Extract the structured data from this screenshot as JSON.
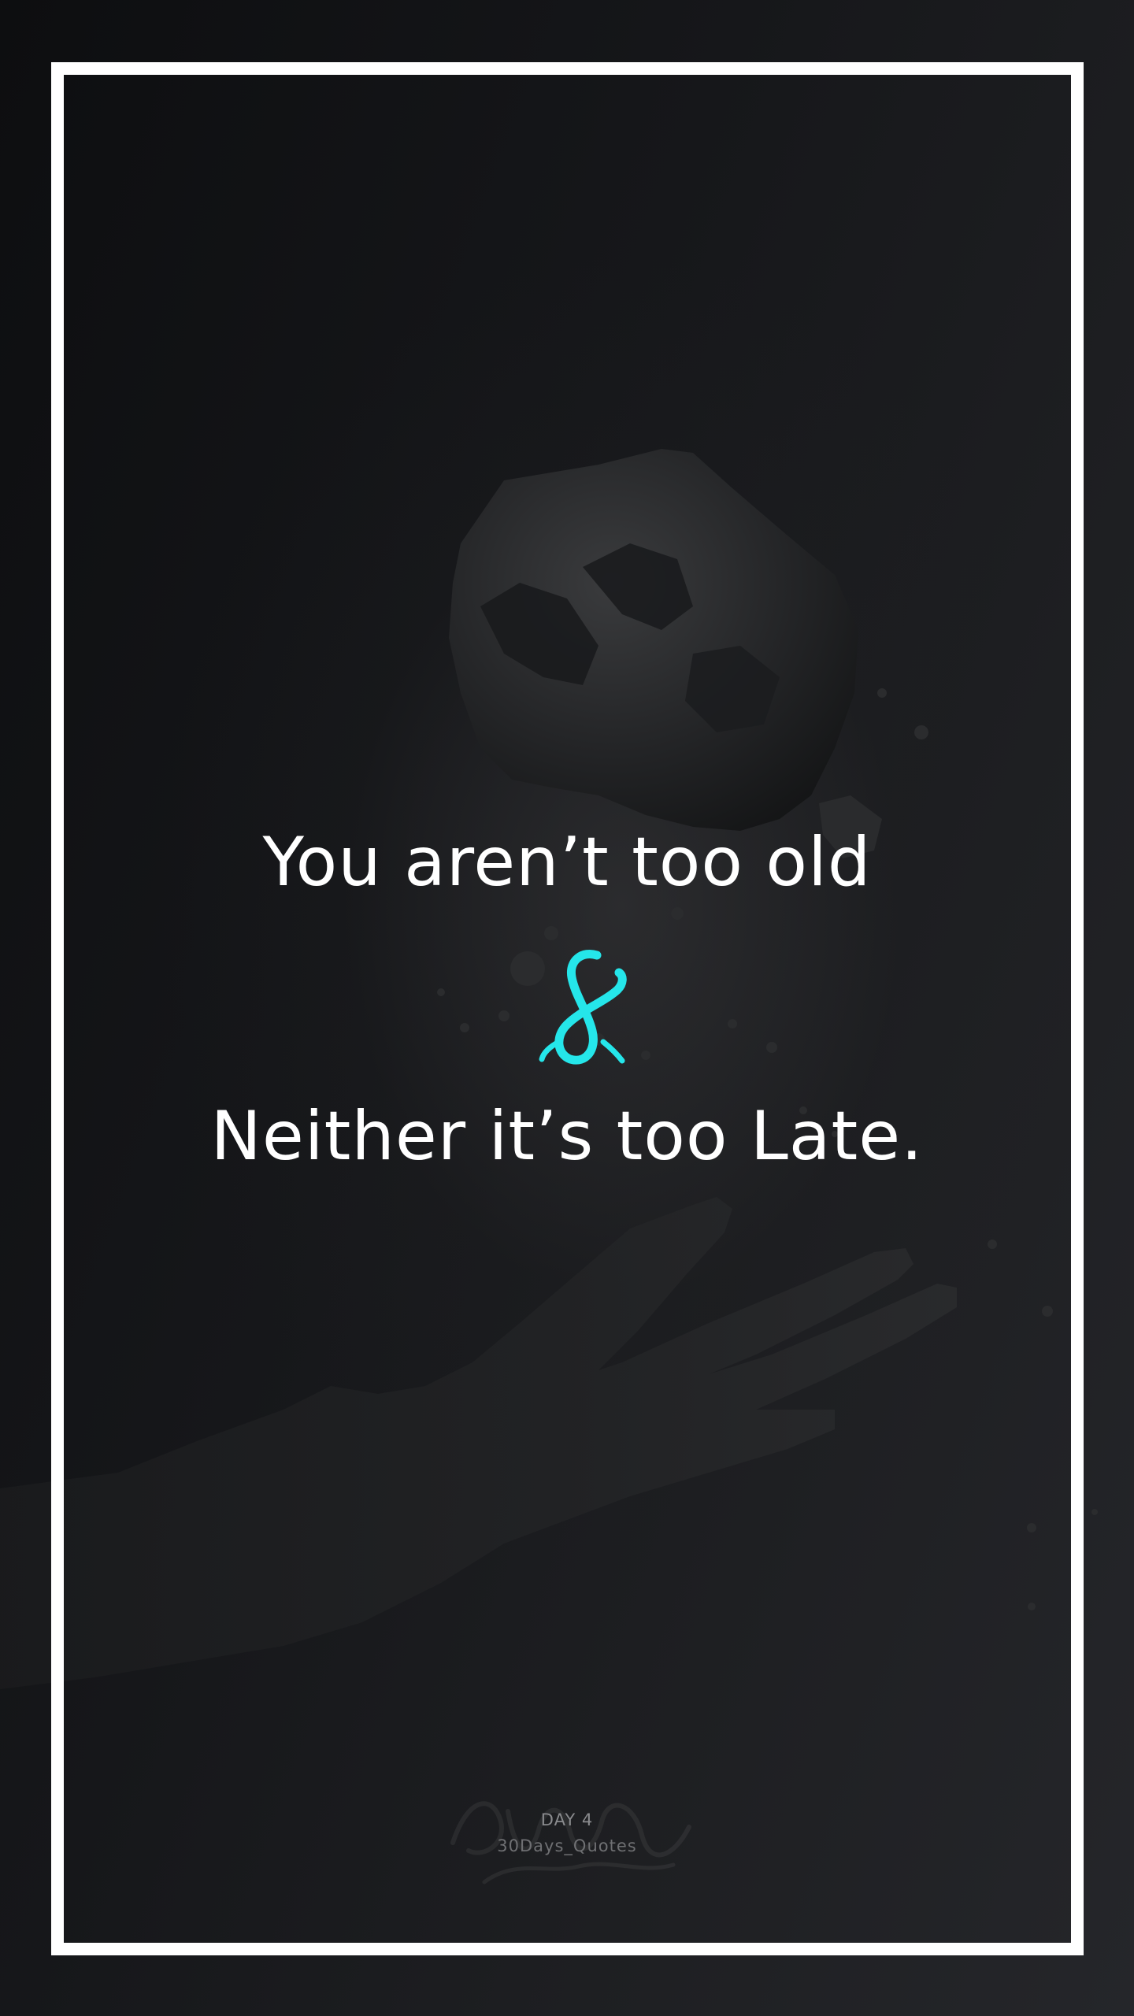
{
  "quote": {
    "line_1": "You aren’t too old",
    "ampersand_icon": "cyan-brush-ampersand",
    "line_2": "Neither it’s too Late."
  },
  "footer": {
    "day": "DAY 4",
    "series": "30Days_Quotes"
  },
  "colors": {
    "background": "#121315",
    "frame": "#ffffff",
    "text": "#ffffff",
    "accent": "#25e6ea",
    "footer_text": "#8a8b8e"
  }
}
